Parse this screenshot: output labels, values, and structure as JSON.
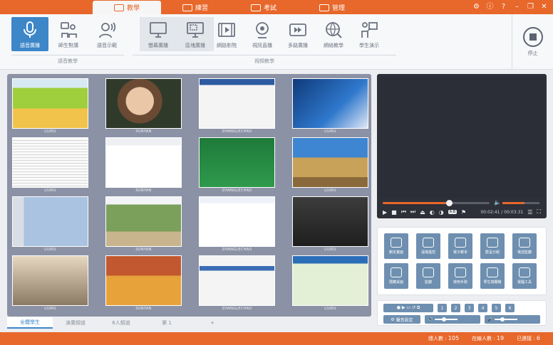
{
  "tabs": [
    {
      "label": "教學",
      "icon": "teach-icon",
      "active": true
    },
    {
      "label": "練習",
      "icon": "practice-icon",
      "active": false
    },
    {
      "label": "考試",
      "icon": "exam-icon",
      "active": false
    },
    {
      "label": "管理",
      "icon": "gear-icon",
      "active": false
    }
  ],
  "toolbar": {
    "voice_group_label": "語音教學",
    "screen_group_label": "視頻教學",
    "voice_buttons": [
      "語音廣播",
      "師生對講",
      "語音示範"
    ],
    "screen_buttons": [
      "螢幕廣播",
      "區塊廣播",
      "網路影院",
      "視訊直播",
      "多路廣播",
      "網絡教學",
      "學生演示"
    ],
    "stop_label": "停止"
  },
  "grid": {
    "captions": [
      "LIURU",
      "SUNYAN",
      "ZHANGLECHAO",
      "LIURU",
      "LIURU",
      "SUNYAN",
      "ZHANGLECHAO",
      "LIURU",
      "LIURU",
      "SUNYAN",
      "ZHANGLECHAO",
      "LIURU",
      "LIURU",
      "SUNYAN",
      "ZHANGLECHAO",
      "LIURU"
    ]
  },
  "bottom_tabs": [
    "全體學生",
    "演廣頻道",
    "6人頻道",
    "第 1",
    "+"
  ],
  "video": {
    "time": "00:02:41 / 00:03:31",
    "progress": 0.62,
    "volume": 0.6,
    "speed_badge": "A-B"
  },
  "tools": [
    "鎖定畫面",
    "遠端遙控",
    "電子教本",
    "群呈分組",
    "電話監聽",
    "隱藏桌面",
    "監聽",
    "使用手勢",
    "學生端關機",
    "電腦工具"
  ],
  "screens": {
    "numbers": [
      "1",
      "2",
      "3",
      "4",
      "5",
      "6"
    ],
    "settings_label": "聲音設定"
  },
  "status": {
    "online_label": "總人數 :",
    "online_value": "105",
    "login_label": "在線人數 :",
    "login_value": "19",
    "hand_label": "已連接 :",
    "hand_value": "6"
  }
}
